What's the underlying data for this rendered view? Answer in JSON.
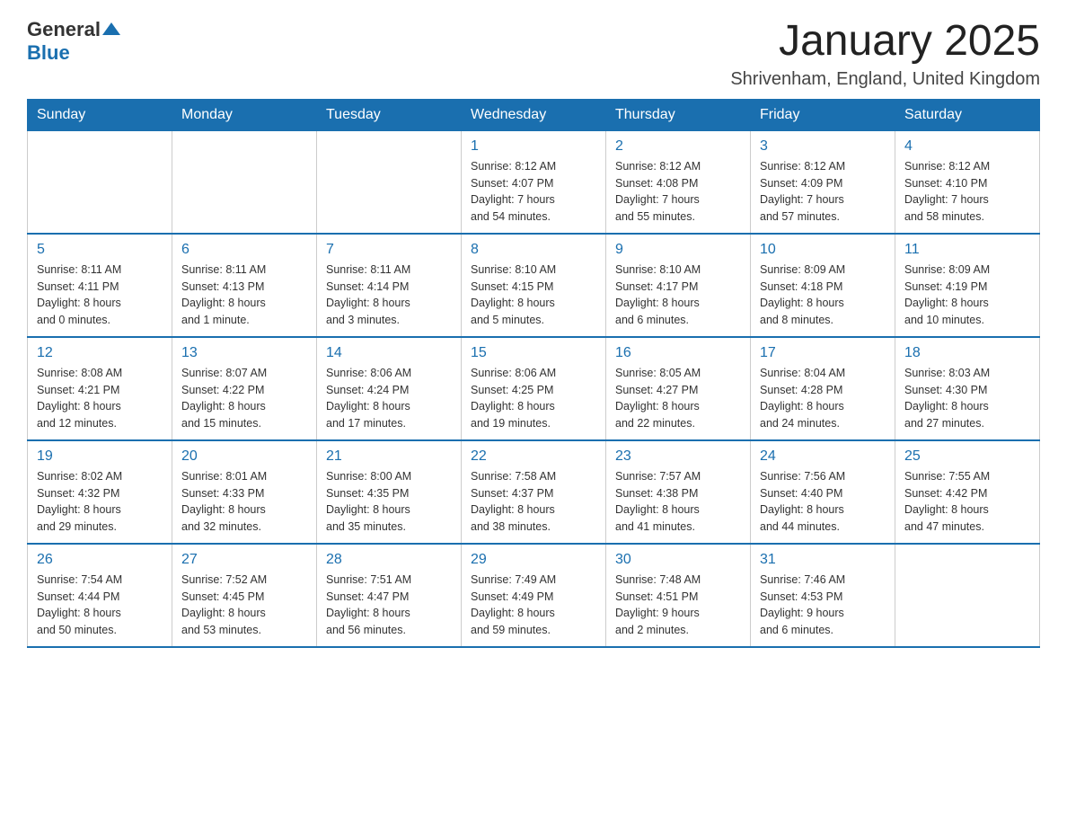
{
  "logo": {
    "text_general": "General",
    "text_blue": "Blue"
  },
  "header": {
    "month_year": "January 2025",
    "location": "Shrivenham, England, United Kingdom"
  },
  "weekdays": [
    "Sunday",
    "Monday",
    "Tuesday",
    "Wednesday",
    "Thursday",
    "Friday",
    "Saturday"
  ],
  "weeks": [
    [
      {
        "day": "",
        "info": ""
      },
      {
        "day": "",
        "info": ""
      },
      {
        "day": "",
        "info": ""
      },
      {
        "day": "1",
        "info": "Sunrise: 8:12 AM\nSunset: 4:07 PM\nDaylight: 7 hours\nand 54 minutes."
      },
      {
        "day": "2",
        "info": "Sunrise: 8:12 AM\nSunset: 4:08 PM\nDaylight: 7 hours\nand 55 minutes."
      },
      {
        "day": "3",
        "info": "Sunrise: 8:12 AM\nSunset: 4:09 PM\nDaylight: 7 hours\nand 57 minutes."
      },
      {
        "day": "4",
        "info": "Sunrise: 8:12 AM\nSunset: 4:10 PM\nDaylight: 7 hours\nand 58 minutes."
      }
    ],
    [
      {
        "day": "5",
        "info": "Sunrise: 8:11 AM\nSunset: 4:11 PM\nDaylight: 8 hours\nand 0 minutes."
      },
      {
        "day": "6",
        "info": "Sunrise: 8:11 AM\nSunset: 4:13 PM\nDaylight: 8 hours\nand 1 minute."
      },
      {
        "day": "7",
        "info": "Sunrise: 8:11 AM\nSunset: 4:14 PM\nDaylight: 8 hours\nand 3 minutes."
      },
      {
        "day": "8",
        "info": "Sunrise: 8:10 AM\nSunset: 4:15 PM\nDaylight: 8 hours\nand 5 minutes."
      },
      {
        "day": "9",
        "info": "Sunrise: 8:10 AM\nSunset: 4:17 PM\nDaylight: 8 hours\nand 6 minutes."
      },
      {
        "day": "10",
        "info": "Sunrise: 8:09 AM\nSunset: 4:18 PM\nDaylight: 8 hours\nand 8 minutes."
      },
      {
        "day": "11",
        "info": "Sunrise: 8:09 AM\nSunset: 4:19 PM\nDaylight: 8 hours\nand 10 minutes."
      }
    ],
    [
      {
        "day": "12",
        "info": "Sunrise: 8:08 AM\nSunset: 4:21 PM\nDaylight: 8 hours\nand 12 minutes."
      },
      {
        "day": "13",
        "info": "Sunrise: 8:07 AM\nSunset: 4:22 PM\nDaylight: 8 hours\nand 15 minutes."
      },
      {
        "day": "14",
        "info": "Sunrise: 8:06 AM\nSunset: 4:24 PM\nDaylight: 8 hours\nand 17 minutes."
      },
      {
        "day": "15",
        "info": "Sunrise: 8:06 AM\nSunset: 4:25 PM\nDaylight: 8 hours\nand 19 minutes."
      },
      {
        "day": "16",
        "info": "Sunrise: 8:05 AM\nSunset: 4:27 PM\nDaylight: 8 hours\nand 22 minutes."
      },
      {
        "day": "17",
        "info": "Sunrise: 8:04 AM\nSunset: 4:28 PM\nDaylight: 8 hours\nand 24 minutes."
      },
      {
        "day": "18",
        "info": "Sunrise: 8:03 AM\nSunset: 4:30 PM\nDaylight: 8 hours\nand 27 minutes."
      }
    ],
    [
      {
        "day": "19",
        "info": "Sunrise: 8:02 AM\nSunset: 4:32 PM\nDaylight: 8 hours\nand 29 minutes."
      },
      {
        "day": "20",
        "info": "Sunrise: 8:01 AM\nSunset: 4:33 PM\nDaylight: 8 hours\nand 32 minutes."
      },
      {
        "day": "21",
        "info": "Sunrise: 8:00 AM\nSunset: 4:35 PM\nDaylight: 8 hours\nand 35 minutes."
      },
      {
        "day": "22",
        "info": "Sunrise: 7:58 AM\nSunset: 4:37 PM\nDaylight: 8 hours\nand 38 minutes."
      },
      {
        "day": "23",
        "info": "Sunrise: 7:57 AM\nSunset: 4:38 PM\nDaylight: 8 hours\nand 41 minutes."
      },
      {
        "day": "24",
        "info": "Sunrise: 7:56 AM\nSunset: 4:40 PM\nDaylight: 8 hours\nand 44 minutes."
      },
      {
        "day": "25",
        "info": "Sunrise: 7:55 AM\nSunset: 4:42 PM\nDaylight: 8 hours\nand 47 minutes."
      }
    ],
    [
      {
        "day": "26",
        "info": "Sunrise: 7:54 AM\nSunset: 4:44 PM\nDaylight: 8 hours\nand 50 minutes."
      },
      {
        "day": "27",
        "info": "Sunrise: 7:52 AM\nSunset: 4:45 PM\nDaylight: 8 hours\nand 53 minutes."
      },
      {
        "day": "28",
        "info": "Sunrise: 7:51 AM\nSunset: 4:47 PM\nDaylight: 8 hours\nand 56 minutes."
      },
      {
        "day": "29",
        "info": "Sunrise: 7:49 AM\nSunset: 4:49 PM\nDaylight: 8 hours\nand 59 minutes."
      },
      {
        "day": "30",
        "info": "Sunrise: 7:48 AM\nSunset: 4:51 PM\nDaylight: 9 hours\nand 2 minutes."
      },
      {
        "day": "31",
        "info": "Sunrise: 7:46 AM\nSunset: 4:53 PM\nDaylight: 9 hours\nand 6 minutes."
      },
      {
        "day": "",
        "info": ""
      }
    ]
  ]
}
